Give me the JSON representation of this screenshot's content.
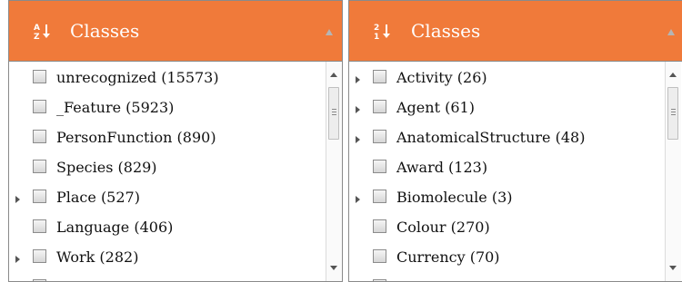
{
  "left_panel": {
    "title": "Classes",
    "sort_icon": "sort-alpha-az-icon",
    "items": [
      {
        "label": "unrecognized (15573)",
        "expandable": false
      },
      {
        "label": "_Feature (5923)",
        "expandable": false
      },
      {
        "label": "PersonFunction (890)",
        "expandable": false
      },
      {
        "label": "Species (829)",
        "expandable": false
      },
      {
        "label": "Place (527)",
        "expandable": true
      },
      {
        "label": "Language (406)",
        "expandable": false
      },
      {
        "label": "Work (282)",
        "expandable": true
      }
    ]
  },
  "right_panel": {
    "title": "Classes",
    "sort_icon": "sort-numeric-21-icon",
    "items": [
      {
        "label": "Activity (26)",
        "expandable": true
      },
      {
        "label": "Agent (61)",
        "expandable": true
      },
      {
        "label": "AnatomicalStructure (48)",
        "expandable": true
      },
      {
        "label": "Award (123)",
        "expandable": false
      },
      {
        "label": "Biomolecule (3)",
        "expandable": true
      },
      {
        "label": "Colour (270)",
        "expandable": false
      },
      {
        "label": "Currency (70)",
        "expandable": false
      }
    ]
  },
  "colors": {
    "header": "#f07a3a",
    "header_text": "#ffffff"
  }
}
